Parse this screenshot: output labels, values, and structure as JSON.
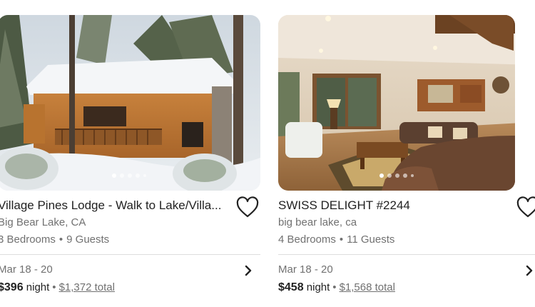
{
  "listings": [
    {
      "title": "Village Pines Lodge - Walk to Lake/Villa...",
      "location": "Big Bear Lake, CA",
      "bedrooms": "3 Bedrooms",
      "guests": "9 Guests",
      "dates": "Mar 18 - 20",
      "price": "$396",
      "price_unit": "night",
      "total": "$1,372 total",
      "photo_icon": "snowy-cabin-photo"
    },
    {
      "title": "SWISS DELIGHT #2244",
      "location": "big bear lake, ca",
      "bedrooms": "4 Bedrooms",
      "guests": "11 Guests",
      "dates": "Mar 18 - 20",
      "price": "$458",
      "price_unit": "night",
      "total": "$1,568 total",
      "photo_icon": "living-room-photo"
    }
  ],
  "separator": "•",
  "colors": {
    "text_primary": "#222222",
    "text_secondary": "#717171",
    "divider": "#dddddd"
  }
}
